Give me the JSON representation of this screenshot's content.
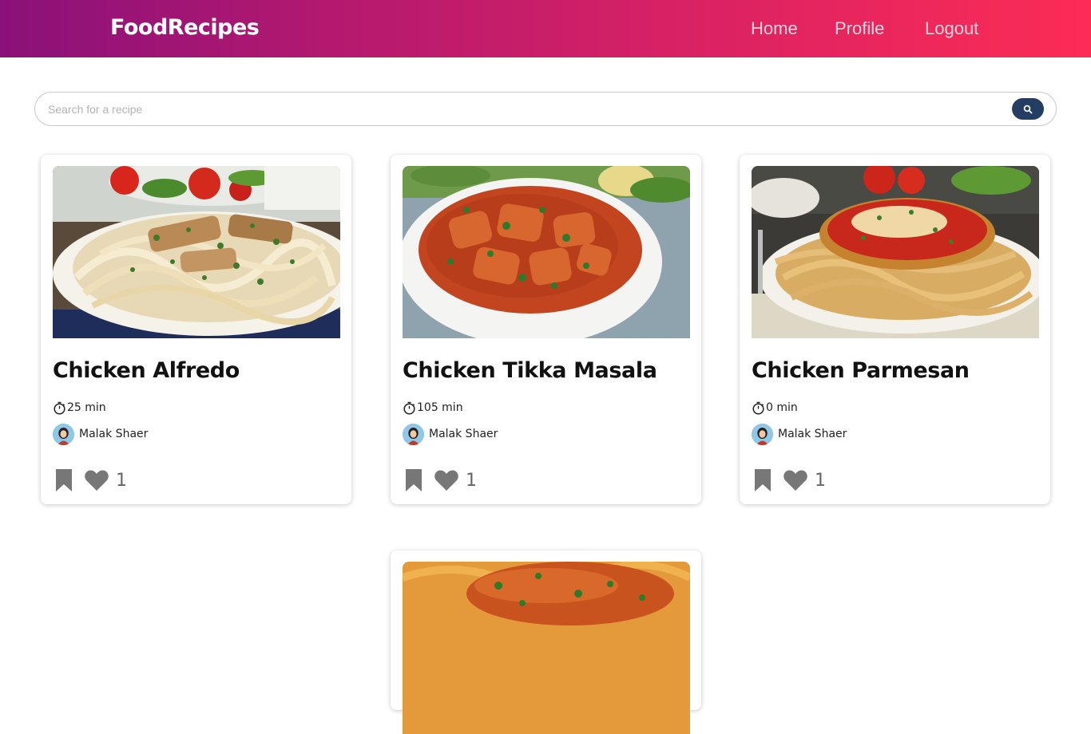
{
  "header": {
    "brand": "FoodRecipes",
    "nav": {
      "home": "Home",
      "profile": "Profile",
      "logout": "Logout"
    }
  },
  "search": {
    "placeholder": "Search for a recipe",
    "value": ""
  },
  "recipes": [
    {
      "title": "Chicken Alfredo",
      "time": "25 min",
      "author": "Malak Shaer",
      "likes": "1",
      "image": "fettuccine-alfredo-photo"
    },
    {
      "title": "Chicken Tikka Masala",
      "time": "105 min",
      "author": "Malak Shaer",
      "likes": "1",
      "image": "tikka-masala-photo"
    },
    {
      "title": "Chicken Parmesan",
      "time": "0 min",
      "author": "Malak Shaer",
      "likes": "1",
      "image": "chicken-parmesan-photo"
    },
    {
      "image": "pasta-dish-photo"
    }
  ],
  "icons": {
    "search": "search-icon",
    "timer": "stopwatch-icon",
    "bookmark": "bookmark-icon",
    "like": "heart-icon"
  },
  "colors": {
    "header_gradient_start": "#8a1179",
    "header_gradient_end": "#fc2c55",
    "search_button": "#243e63",
    "icon_gray": "#777777"
  }
}
